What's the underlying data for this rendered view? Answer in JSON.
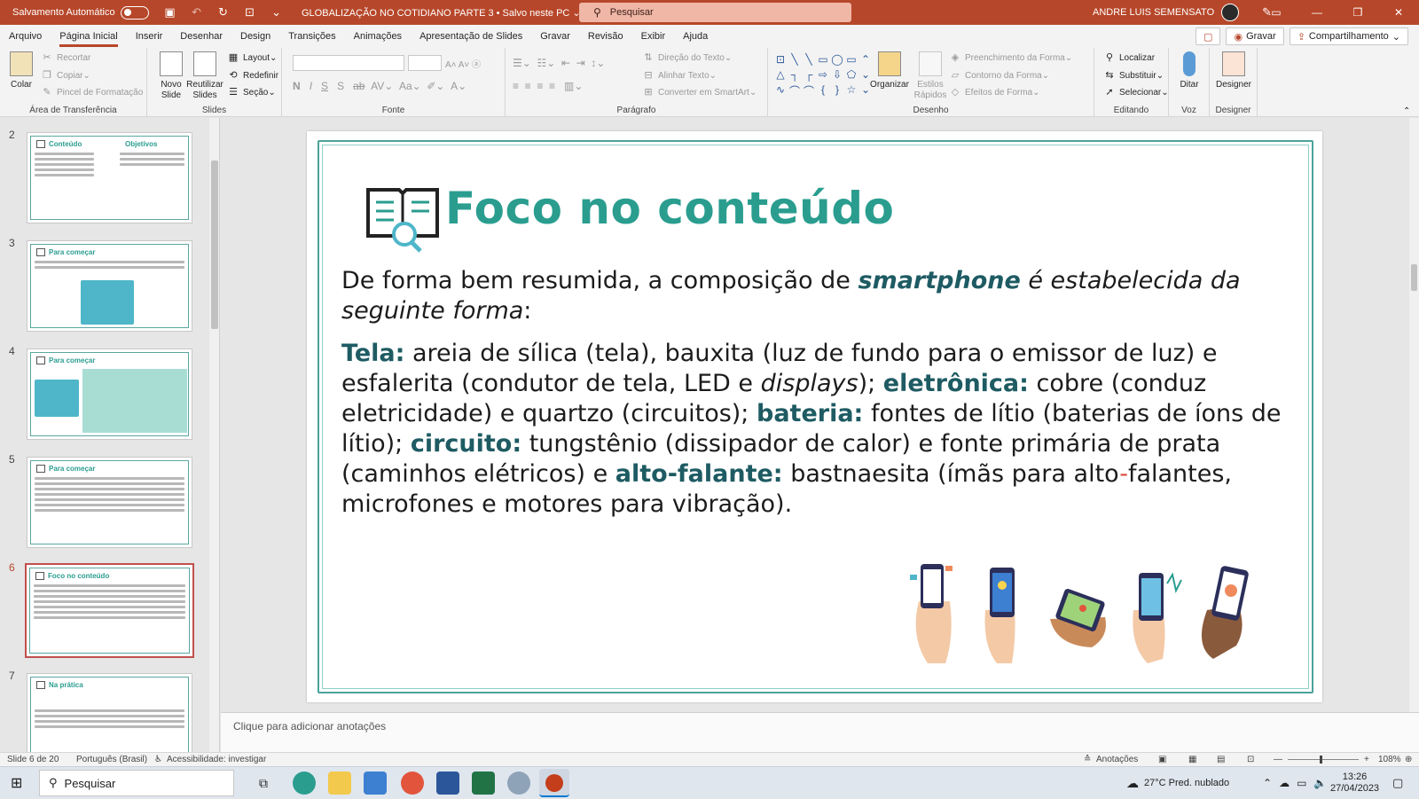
{
  "titlebar": {
    "autosave_label": "Salvamento Automático",
    "document_title": "GLOBALIZAÇÃO NO COTIDIANO PARTE 3  •  Salvo neste PC ⌄",
    "search_placeholder": "Pesquisar",
    "user_name": "ANDRE LUIS SEMENSATO"
  },
  "menu": {
    "items": [
      "Arquivo",
      "Página Inicial",
      "Inserir",
      "Desenhar",
      "Design",
      "Transições",
      "Animações",
      "Apresentação de Slides",
      "Gravar",
      "Revisão",
      "Exibir",
      "Ajuda"
    ],
    "record_label": "Gravar",
    "share_label": "Compartilhamento"
  },
  "ribbon": {
    "clipboard": {
      "paste": "Colar",
      "cut": "Recortar",
      "copy": "Copiar",
      "format_painter": "Pincel de Formatação",
      "label": "Área de Transferência"
    },
    "slides": {
      "new_slide": "Novo Slide",
      "reuse": "Reutilizar Slides",
      "layout": "Layout",
      "reset": "Redefinir",
      "section": "Seção",
      "label": "Slides"
    },
    "font": {
      "label": "Fonte"
    },
    "paragraph": {
      "text_direction": "Direção do Texto",
      "align_text": "Alinhar Texto",
      "smartart": "Converter em SmartArt",
      "label": "Parágrafo"
    },
    "drawing": {
      "arrange": "Organizar",
      "quick_styles": "Estilos Rápidos",
      "shape_fill": "Preenchimento da Forma",
      "shape_outline": "Contorno da Forma",
      "shape_effects": "Efeitos de Forma",
      "label": "Desenho"
    },
    "editing": {
      "find": "Localizar",
      "replace": "Substituir",
      "select": "Selecionar",
      "label": "Editando"
    },
    "voice": {
      "dictate": "Ditar",
      "label": "Voz"
    },
    "designer": {
      "designer": "Designer",
      "label": "Designer"
    }
  },
  "thumbnails": [
    {
      "num": "2",
      "title": "Conteúdo"
    },
    {
      "num": "3",
      "title": "Para começar"
    },
    {
      "num": "4",
      "title": "Para começar"
    },
    {
      "num": "5",
      "title": "Para começar"
    },
    {
      "num": "6",
      "title": "Foco no conteúdo"
    },
    {
      "num": "7",
      "title": "Na prática"
    }
  ],
  "slide": {
    "title": "Foco no conteúdo",
    "p1_a": "De forma bem resumida, a composição de ",
    "p1_b": "smartphone",
    "p1_c": " é estabelecida da seguinte forma",
    "p1_d": ":",
    "t1": "Tela:",
    "t1_text": " areia de sílica (tela), bauxita (luz de fundo para o emissor de luz) e esfalerita (condutor de tela, LED e ",
    "t1_it": "displays",
    "t1_end": "); ",
    "t2": "eletrônica:",
    "t2_text": " cobre (conduz eletricidade) e quartzo (circuitos); ",
    "t3": "bateria:",
    "t3_text": " fontes de lítio (baterias de íons de lítio); ",
    "t4": "circuito:",
    "t4_text": " tungstênio (dissipador de calor) e fonte primária de prata (caminhos elétricos) e ",
    "t5": "alto-falante:",
    "t5_text": " bastnaesita (ímãs para alto",
    "t5_dash": "-",
    "t5_end": "falantes, microfones e motores para vibração)."
  },
  "notes_placeholder": "Clique para adicionar anotações",
  "status": {
    "slide_of": "Slide 6 de 20",
    "language": "Português (Brasil)",
    "accessibility": "Acessibilidade: investigar",
    "notes": "Anotações",
    "zoom": "108%"
  },
  "taskbar": {
    "search": "Pesquisar",
    "weather": "27°C  Pred. nublado",
    "time": "13:26",
    "date": "27/04/2023"
  },
  "colors": {
    "accent": "#b7472a",
    "teal": "#2a9d8f",
    "dark_teal": "#1e5b63"
  }
}
